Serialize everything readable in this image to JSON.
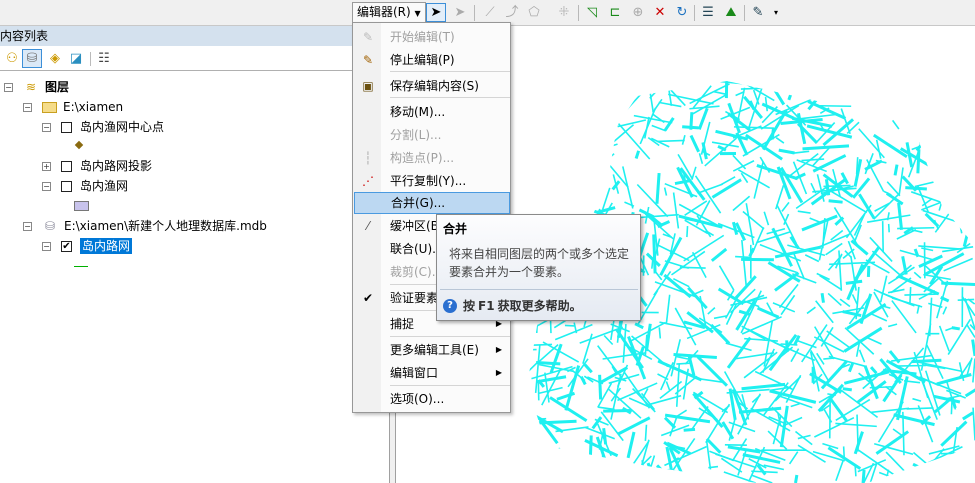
{
  "toolbar": {
    "editor_menu": "编辑器(R)",
    "icons": [
      "select-tool-icon",
      "edit-annotation-icon",
      "straight-segment-icon",
      "endpoint-arc-icon",
      "polygon-tool-icon",
      "cut-polygons-icon",
      "topology-edit-icon",
      "reshape-icon",
      "split-icon",
      "intersect-icon",
      "rotate-icon",
      "attributes-icon",
      "sketch-properties-icon",
      "create-features-icon"
    ]
  },
  "toc": {
    "title": "内容列表",
    "root": "图层",
    "folder": "E:\\xiamen",
    "layers": [
      "岛内渔网中心点",
      "岛内路网投影",
      "岛内渔网"
    ],
    "gdb": "E:\\xiamen\\新建个人地理数据库.mdb",
    "gdb_layer": "岛内路网"
  },
  "menu": {
    "items": [
      {
        "label": "开始编辑(T)",
        "disabled": true
      },
      {
        "label": "停止编辑(P)"
      },
      {
        "label": "保存编辑内容(S)"
      },
      {
        "label": "移动(M)..."
      },
      {
        "label": "分割(L)...",
        "disabled": true
      },
      {
        "label": "构造点(P)...",
        "disabled": true
      },
      {
        "label": "平行复制(Y)..."
      },
      {
        "label": "合并(G)..."
      },
      {
        "label": "缓冲区(B)..."
      },
      {
        "label": "联合(U)..."
      },
      {
        "label": "裁剪(C)...",
        "disabled": true
      },
      {
        "label": "验证要素(I)"
      },
      {
        "label": "捕捉"
      },
      {
        "label": "更多编辑工具(E)"
      },
      {
        "label": "编辑窗口"
      },
      {
        "label": "选项(O)..."
      }
    ]
  },
  "tooltip": {
    "title": "合并",
    "body": "将来自相同图层的两个或多个选定要素合并为一个要素。",
    "help_prefix": "按 ",
    "help_key": "F1",
    "help_suffix": " 获取更多帮助。"
  },
  "colors": {
    "roads": "#1ff0f0",
    "highlight": "#bcd8f2",
    "selected": "#0078d7"
  }
}
